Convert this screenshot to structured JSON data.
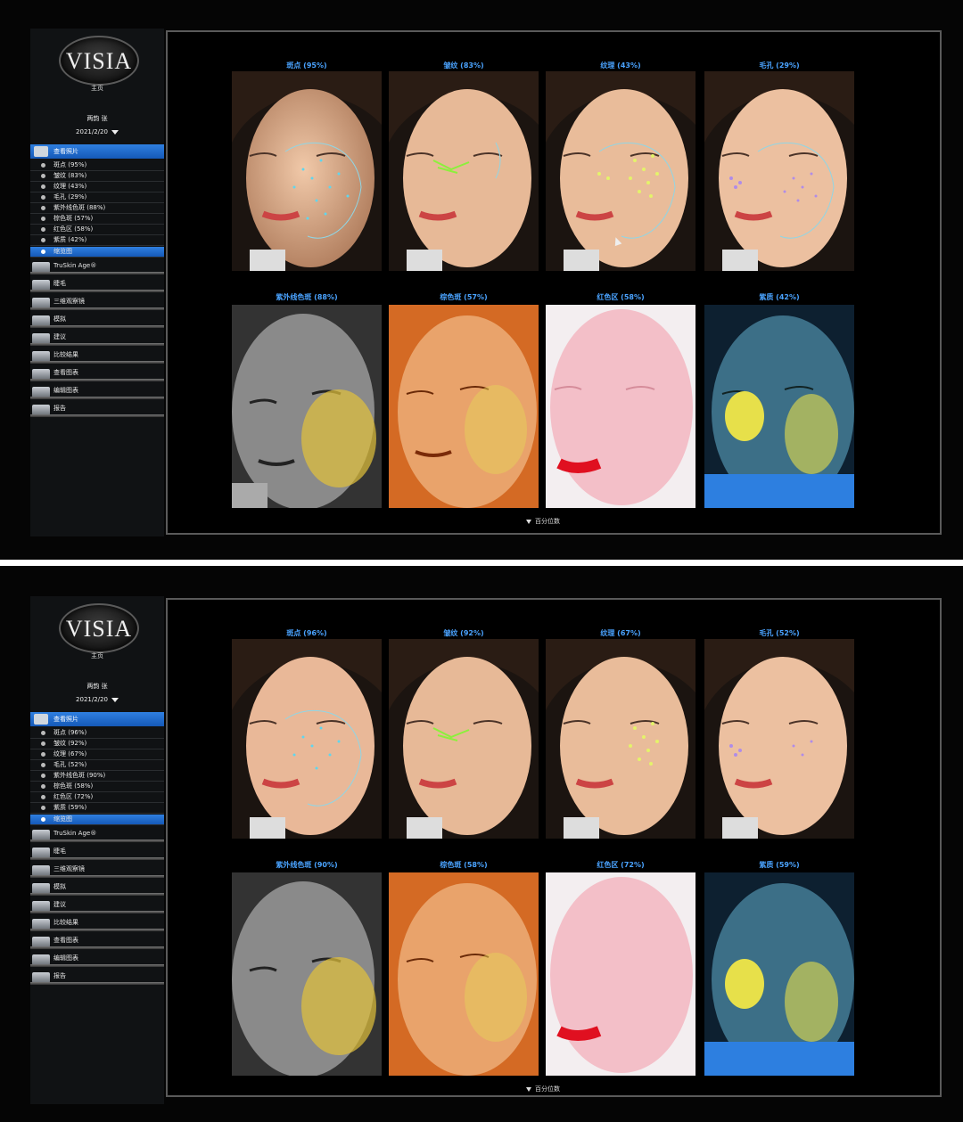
{
  "app": {
    "logo": "VISIA",
    "home_label": "主页"
  },
  "panels": [
    {
      "user": "两韵 张",
      "date": "2021/2/20",
      "menu_head": "查看照片",
      "submenu": [
        "斑点 (95%)",
        "皱纹 (83%)",
        "纹理 (43%)",
        "毛孔 (29%)",
        "紫外线色斑 (88%)",
        "棕色斑 (57%)",
        "红色区 (58%)",
        "紫质 (42%)",
        "缩览图"
      ],
      "nav": [
        "TruSkin Age®",
        "睫毛",
        "三维观察镜",
        "模拟",
        "建议",
        "比较结果",
        "查看图表",
        "编辑图表",
        "报告"
      ],
      "tiles_top": [
        "斑点 (95%)",
        "皱纹 (83%)",
        "纹理 (43%)",
        "毛孔 (29%)"
      ],
      "tiles_bottom": [
        "紫外线色斑 (88%)",
        "棕色斑 (57%)",
        "红色区 (58%)",
        "紫质 (42%)"
      ],
      "footer": "百分位数"
    },
    {
      "user": "两韵 张",
      "date": "2021/2/20",
      "menu_head": "查看照片",
      "submenu": [
        "斑点 (96%)",
        "皱纹 (92%)",
        "纹理 (67%)",
        "毛孔 (52%)",
        "紫外线色斑 (90%)",
        "棕色斑 (58%)",
        "红色区 (72%)",
        "紫质 (59%)",
        "缩览图"
      ],
      "nav": [
        "TruSkin Age®",
        "睫毛",
        "三维观察镜",
        "模拟",
        "建议",
        "比较结果",
        "查看图表",
        "编辑图表",
        "报告"
      ],
      "tiles_top": [
        "斑点 (96%)",
        "皱纹 (92%)",
        "纹理 (67%)",
        "毛孔 (52%)"
      ],
      "tiles_bottom": [
        "紫外线色斑 (90%)",
        "棕色斑 (58%)",
        "红色区 (72%)",
        "紫质 (59%)"
      ],
      "footer": "百分位数"
    }
  ],
  "icons": {
    "caret": "chevron-down-icon",
    "menu": "camera-icon"
  },
  "colors": {
    "accent": "#2f7fe0",
    "caption": "#4aa3ff"
  }
}
